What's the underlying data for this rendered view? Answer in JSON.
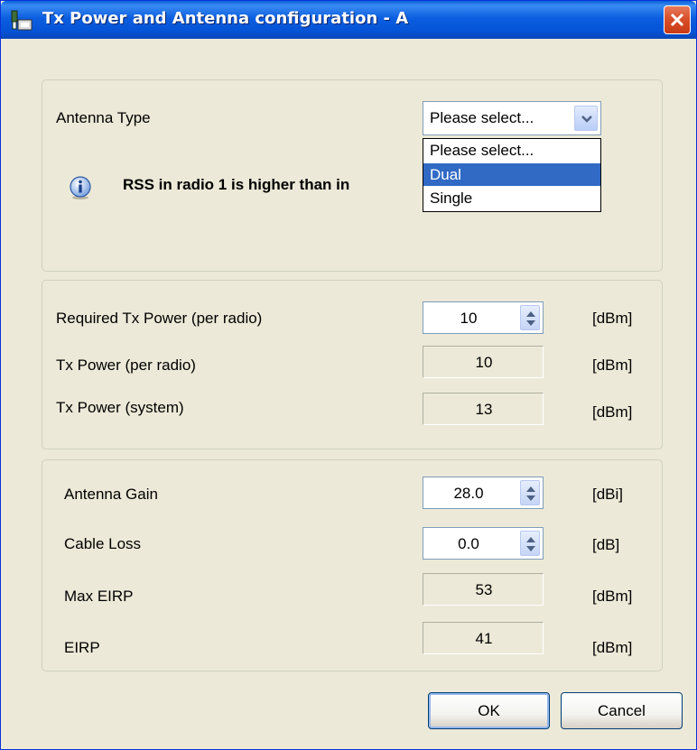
{
  "window": {
    "title": "Tx Power and Antenna configuration - A"
  },
  "antenna": {
    "label": "Antenna Type",
    "selected": "Please select...",
    "options": [
      "Please select...",
      "Dual",
      "Single"
    ],
    "highlighted_option": "Dual",
    "info_message": "RSS in radio 1 is higher than in"
  },
  "power": {
    "required_label": "Required Tx Power (per radio)",
    "required_value": "10",
    "required_unit": "[dBm]",
    "per_radio_label": "Tx Power (per radio)",
    "per_radio_value": "10",
    "per_radio_unit": "[dBm]",
    "system_label": "Tx Power (system)",
    "system_value": "13",
    "system_unit": "[dBm]"
  },
  "gain": {
    "antenna_gain_label": "Antenna Gain",
    "antenna_gain_value": "28.0",
    "antenna_gain_unit": "[dBi]",
    "cable_loss_label": "Cable Loss",
    "cable_loss_value": "0.0",
    "cable_loss_unit": "[dB]",
    "max_eirp_label": "Max EIRP",
    "max_eirp_value": "53",
    "max_eirp_unit": "[dBm]",
    "eirp_label": "EIRP",
    "eirp_value": "41",
    "eirp_unit": "[dBm]"
  },
  "buttons": {
    "ok": "OK",
    "cancel": "Cancel"
  },
  "colors": {
    "titlebar": "#0553d6",
    "selection": "#316ac5",
    "close": "#d9502b",
    "dialog_bg": "#ece9d8"
  }
}
